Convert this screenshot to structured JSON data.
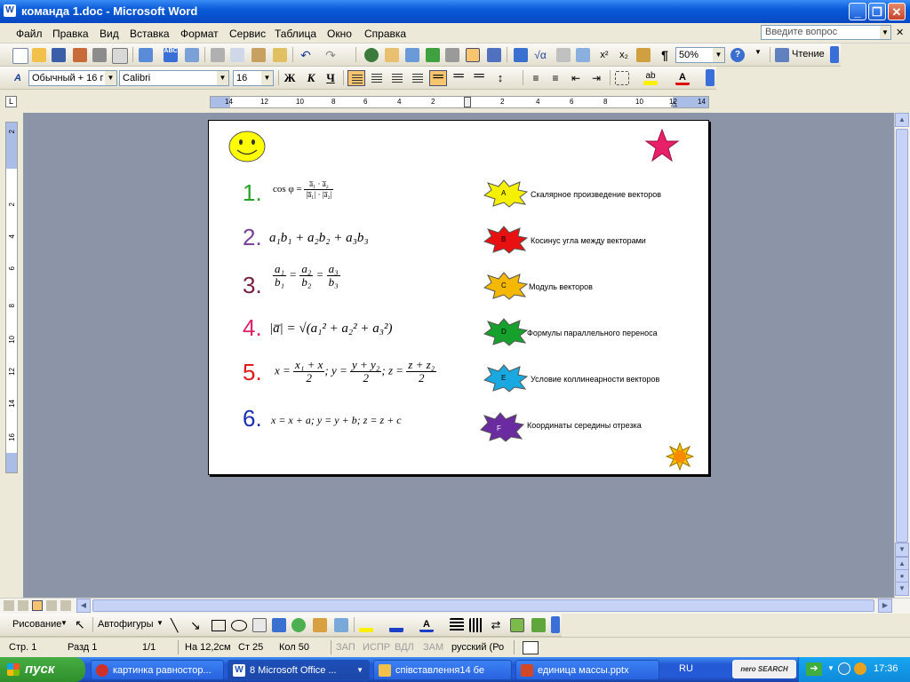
{
  "window": {
    "title": "команда 1.doc - Microsoft Word",
    "app_icon": "word-icon"
  },
  "menu": [
    "Файл",
    "Правка",
    "Вид",
    "Вставка",
    "Формат",
    "Сервис",
    "Таблица",
    "Окно",
    "Справка"
  ],
  "help_box": {
    "placeholder": "Введите вопрос"
  },
  "standard_toolbar": {
    "zoom": "50%",
    "read_label": "Чтение"
  },
  "format_toolbar": {
    "style": "Обычный + 16 г",
    "font": "Calibri",
    "size": "16",
    "bold": "Ж",
    "italic": "К",
    "underline": "Ч"
  },
  "ruler": {
    "h_numbers": [
      "14",
      "12",
      "10",
      "8",
      "6",
      "4",
      "2",
      "2",
      "4",
      "6",
      "8",
      "10",
      "12",
      "14"
    ],
    "v_numbers": [
      "2",
      "2",
      "4",
      "6",
      "8",
      "10",
      "12",
      "14",
      "16"
    ]
  },
  "document": {
    "items": [
      {
        "num": "1.",
        "color": "#2aa22a"
      },
      {
        "num": "2.",
        "color": "#7b3f9e"
      },
      {
        "num": "3.",
        "color": "#7a1e3c"
      },
      {
        "num": "4.",
        "color": "#e0226a"
      },
      {
        "num": "5.",
        "color": "#e01b1b"
      },
      {
        "num": "6.",
        "color": "#1a2fb0"
      }
    ],
    "formulas": {
      "f1_cos": "cos φ =",
      "f1_top": "a̅₁ · a̅₂",
      "f1_bottom": "|a̅₁| · |a̅₂|",
      "f2": "a₁b₁ + a₂b₂ + a₃b₃",
      "f3_fracs": [
        {
          "t": "a₁",
          "b": "b₁"
        },
        {
          "t": "a₂",
          "b": "b₂"
        },
        {
          "t": "a₃",
          "b": "b₃"
        }
      ],
      "f4_left": "|a̅|",
      "f4_right": "√(a₁² + a₂² + a₃²)",
      "f5": {
        "x": "x =",
        "x_top": "x₁ + x",
        "y": "; y =",
        "y_top": "y + y₂",
        "z": "; z =",
        "z_top": "z + z₂",
        "den": "2"
      },
      "f6": "x = x + a; y = y + b; z = z + c"
    },
    "answers": [
      {
        "letter": "A",
        "text": "Скалярное произведение векторов",
        "color": "#f5f000"
      },
      {
        "letter": "B",
        "text": "Косинус угла между векторами",
        "color": "#e81010"
      },
      {
        "letter": "C",
        "text": "Модуль векторов",
        "color": "#f5b800"
      },
      {
        "letter": "D",
        "text": "Формулы параллельного переноса",
        "color": "#16a02c"
      },
      {
        "letter": "E",
        "text": "Условие коллинеарности векторов",
        "color": "#1aa8e0"
      },
      {
        "letter": "F",
        "text": "Координаты середины отрезка",
        "color": "#6a2aa0"
      }
    ]
  },
  "draw_toolbar": {
    "draw_label": "Рисование",
    "autoshapes_label": "Автофигуры"
  },
  "status_bar": {
    "page": "Стр. 1",
    "section": "Разд 1",
    "pages": "1/1",
    "position": "На 12,2см",
    "line": "Ст 25",
    "column": "Кол 50",
    "rec": "ЗАП",
    "trk": "ИСПР",
    "ext": "ВДЛ",
    "ovr": "ЗАМ",
    "lang": "русский (Ро"
  },
  "taskbar": {
    "start_label": "пуск",
    "tasks": [
      "картинка равностор...",
      "8 Microsoft Office ...",
      "співставлення14 бе",
      "единица массы.pptx"
    ],
    "lang": "RU",
    "clock": "17:36",
    "search_brand": "nero SEARCH"
  }
}
